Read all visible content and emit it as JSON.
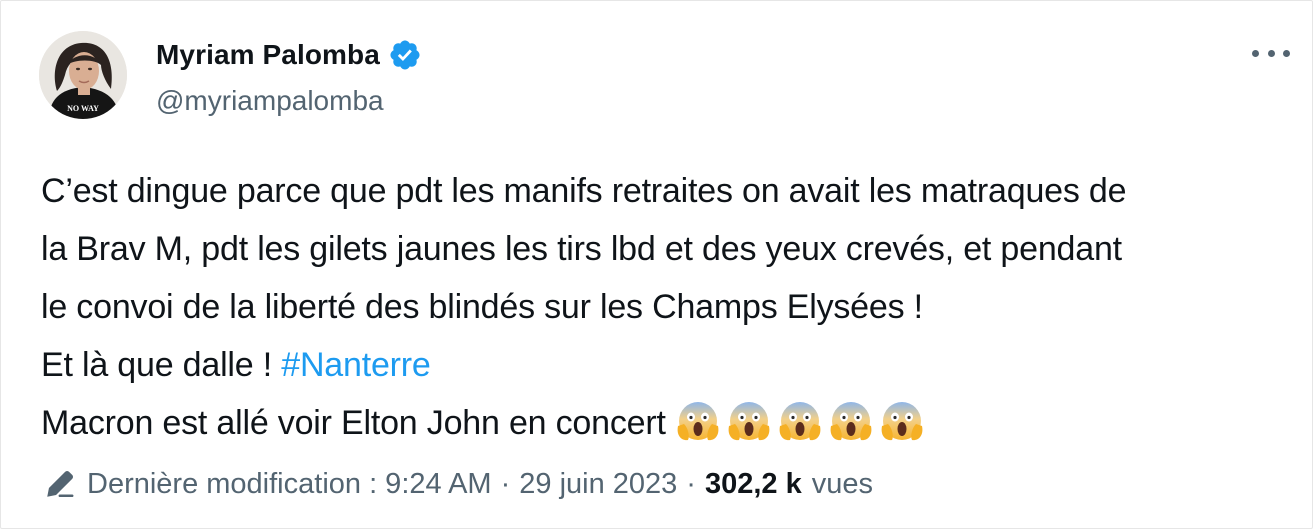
{
  "author": {
    "display_name": "Myriam Palomba",
    "handle": "@myriampalomba",
    "verified": true,
    "avatar_shirt_text": "NO WAY"
  },
  "tweet": {
    "lines": [
      "C’est dingue parce que pdt les manifs retraites on avait les matraques de",
      "la Brav M, pdt les gilets jaunes les tirs lbd et des yeux crevés, et pendant",
      "le convoi de la liberté des blindés sur les Champs Elysées !",
      "Et là que dalle ! ",
      "Macron est allé voir Elton John en concert"
    ],
    "hashtag": "#Nanterre",
    "emoji_count": 5,
    "emoji": "screaming-in-fear"
  },
  "footer": {
    "edited_label": "Dernière modification : 9:24 AM",
    "separator": "·",
    "date": "29 juin 2023",
    "views_count": "302,2 k",
    "views_label": "vues"
  },
  "colors": {
    "link": "#1d9bf0",
    "secondary_text": "#536471",
    "primary_text": "#0f1419",
    "verified_badge": "#1d9bf0"
  }
}
